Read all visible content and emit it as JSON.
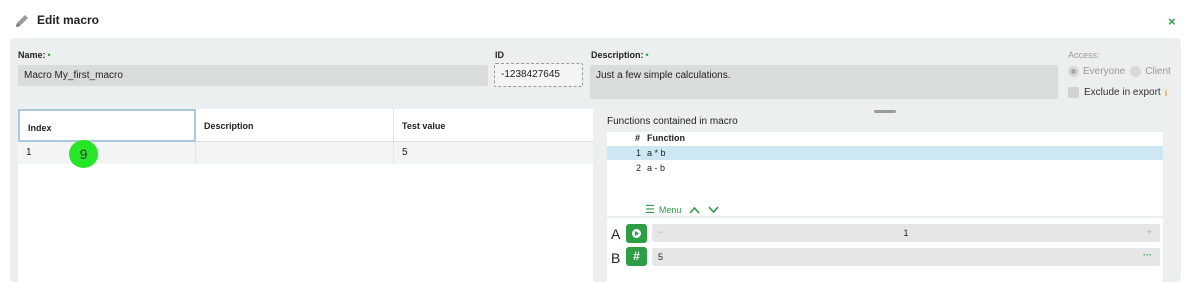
{
  "window": {
    "title": "Edit macro",
    "close_label": "×"
  },
  "form": {
    "name_label": "Name:",
    "name_required": "•",
    "name_value": "Macro My_first_macro",
    "id_label": "ID",
    "id_value": "-1238427645",
    "description_label": "Description:",
    "description_required": "•",
    "description_value": "Just a few simple calculations."
  },
  "access": {
    "label": "Access:",
    "options": [
      "Everyone",
      "Client"
    ],
    "selected": "Everyone",
    "exclude_label": "Exclude in export",
    "info_icon": "i"
  },
  "table": {
    "columns": [
      "Index",
      "Description",
      "Test value"
    ],
    "rows": [
      {
        "index": "1",
        "description": "",
        "test_value": "5"
      }
    ],
    "cursor_marker": "9"
  },
  "functions": {
    "header": "Functions contained in macro",
    "col_num": "#",
    "col_function": "Function",
    "rows": [
      {
        "num": "1",
        "function": "a * b",
        "selected": true
      },
      {
        "num": "2",
        "function": "a - b",
        "selected": false
      }
    ],
    "menu_label": "Menu"
  },
  "params": {
    "a": {
      "letter": "A",
      "button_icon": "play-icon",
      "minus": "−",
      "value": "1",
      "plus": "+"
    },
    "b": {
      "letter": "B",
      "button_icon": "hash-icon",
      "button_glyph": "#",
      "value": "5",
      "more": "···"
    }
  },
  "colors": {
    "accent": "#2e9e46",
    "selection": "#cde8f2",
    "panel": "#eceff0",
    "cursor": "#27e628"
  }
}
